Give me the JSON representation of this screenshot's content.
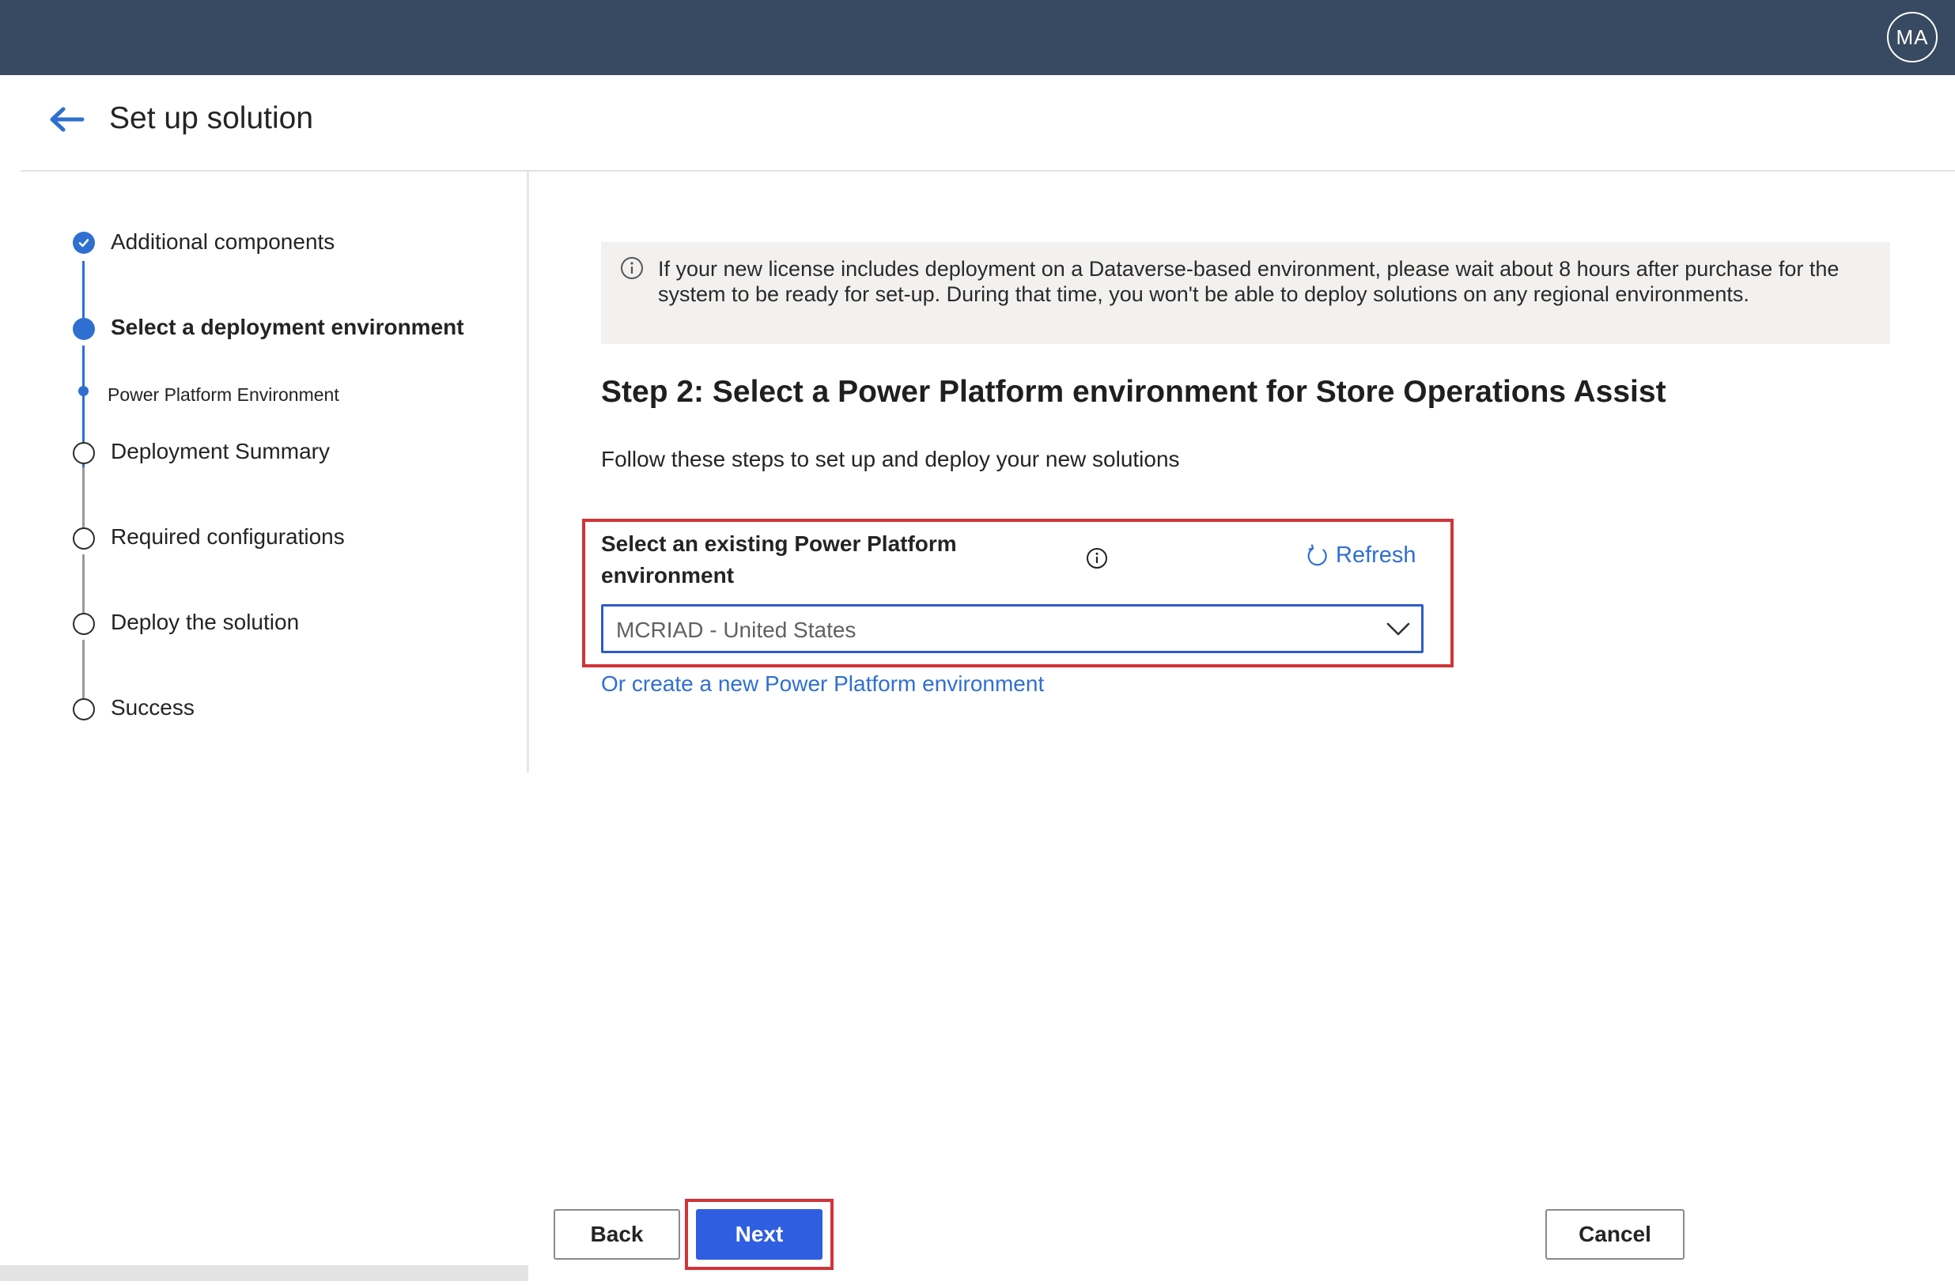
{
  "topbar": {
    "avatar_initials": "MA"
  },
  "header": {
    "title": "Set up solution",
    "back_icon": "arrow-left-icon"
  },
  "stepper": {
    "steps": [
      {
        "label": "Additional components",
        "state": "completed"
      },
      {
        "label": "Select a deployment environment",
        "state": "current"
      },
      {
        "label": "Power Platform Environment",
        "state": "current-substep"
      },
      {
        "label": "Deployment Summary",
        "state": "pending"
      },
      {
        "label": "Required configurations",
        "state": "pending"
      },
      {
        "label": "Deploy the solution",
        "state": "pending"
      },
      {
        "label": "Success",
        "state": "pending"
      }
    ]
  },
  "info_bar": {
    "icon": "info-icon",
    "text": "If your new license includes deployment on a Dataverse-based environment, please wait about 8 hours after purchase for the system to be ready for set-up. During that time, you won't be able to deploy solutions on any regional environments."
  },
  "main": {
    "heading": "Step 2: Select a Power Platform environment for Store Operations Assist",
    "description": "Follow these steps to set up and deploy your new solutions",
    "field_label": "Select an existing Power Platform environment",
    "refresh_label": "Refresh",
    "selected_environment": "MCRIAD - United States",
    "create_link": "Or create a new Power Platform environment"
  },
  "footer": {
    "back_label": "Back",
    "next_label": "Next",
    "cancel_label": "Cancel"
  },
  "colors": {
    "topbar": "#384a61",
    "accent": "#2f6fd1",
    "primary_button": "#2f5ee0",
    "highlight": "#d13438"
  }
}
